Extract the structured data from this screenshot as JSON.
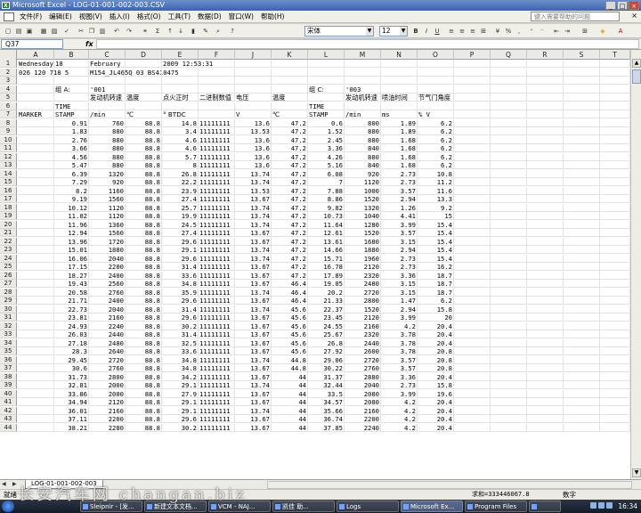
{
  "window": {
    "title": "Microsoft Excel - LOG-01-001-002-003.CSV",
    "controls": [
      "_",
      "□",
      "×"
    ]
  },
  "menu": {
    "items": [
      "文件(F)",
      "编辑(E)",
      "视图(V)",
      "插入(I)",
      "格式(O)",
      "工具(T)",
      "数据(D)",
      "窗口(W)",
      "帮助(H)"
    ],
    "help_placeholder": "键入需要帮助的问题"
  },
  "toolbar": {
    "font": "宋体",
    "font_size": "12",
    "bold": "B",
    "italic": "I",
    "underline": "U",
    "sum": "Σ"
  },
  "formula_bar": {
    "name_box": "Q37",
    "fx": "fx",
    "content": ""
  },
  "columns": [
    "A",
    "B",
    "C",
    "D",
    "E",
    "F",
    "J",
    "K",
    "L",
    "M",
    "N",
    "O",
    "P",
    "Q",
    "R",
    "S",
    "T"
  ],
  "rows": [
    {
      "n": "1",
      "cells": [
        "Wednesday",
        "18",
        "February",
        "",
        "2009 12:53:31",
        "",
        "",
        "",
        "",
        "",
        "",
        "",
        "",
        "",
        "",
        "",
        ""
      ]
    },
    {
      "n": "2",
      "cells": [
        "026 120 718 5",
        "",
        "M154_JL465Q 03_BS410475",
        "",
        "",
        "",
        "",
        "",
        "",
        "",
        "",
        "",
        "",
        "",
        "",
        "",
        ""
      ]
    },
    {
      "n": "3",
      "cells": [
        "",
        "",
        "",
        "",
        "",
        "",
        "",
        "",
        "",
        "",
        "",
        "",
        "",
        "",
        "",
        "",
        ""
      ]
    },
    {
      "n": "4",
      "cells": [
        "",
        "组 A:",
        "'001",
        "",
        "",
        "",
        "",
        "",
        "组 C:",
        "'003",
        "",
        "",
        "",
        "",
        "",
        "",
        ""
      ]
    },
    {
      "n": "5",
      "cells": [
        "",
        "",
        "发动机转速",
        "温度",
        "点火正时",
        "二进制数值",
        "电压",
        "温度",
        "",
        "发动机转速",
        "喷油时间",
        "节气门角度",
        "",
        "",
        "",
        "",
        ""
      ]
    },
    {
      "n": "6",
      "cells": [
        "",
        "TIME",
        "",
        "",
        "",
        "",
        "",
        "",
        "TIME",
        "",
        "",
        "",
        "",
        "",
        "",
        "",
        ""
      ]
    },
    {
      "n": "7",
      "cells": [
        "MARKER",
        "STAMP",
        "/min",
        "℃",
        "° BTDC",
        "",
        "V",
        "℃",
        "STAMP",
        "/min",
        "ms",
        "% V",
        "",
        "",
        "",
        "",
        ""
      ]
    },
    {
      "n": "8",
      "cells": [
        "",
        "0.91",
        "760",
        "88.8",
        "14.8",
        "11111111",
        "13.6",
        "47.2",
        "0.6",
        "800",
        "1.89",
        "6.2",
        "",
        "",
        "",
        "",
        ""
      ]
    },
    {
      "n": "9",
      "cells": [
        "",
        "1.83",
        "880",
        "88.8",
        "3.4",
        "11111111",
        "13.53",
        "47.2",
        "1.52",
        "880",
        "1.89",
        "6.2",
        "",
        "",
        "",
        "",
        ""
      ]
    },
    {
      "n": "10",
      "cells": [
        "",
        "2.76",
        "880",
        "88.8",
        "4.6",
        "11111111",
        "13.6",
        "47.2",
        "2.45",
        "880",
        "1.68",
        "6.2",
        "",
        "",
        "",
        "",
        ""
      ]
    },
    {
      "n": "11",
      "cells": [
        "",
        "3.66",
        "880",
        "88.8",
        "4.6",
        "11111111",
        "13.6",
        "47.2",
        "3.36",
        "840",
        "1.68",
        "6.2",
        "",
        "",
        "",
        "",
        ""
      ]
    },
    {
      "n": "12",
      "cells": [
        "",
        "4.56",
        "880",
        "88.8",
        "5.7",
        "11111111",
        "13.6",
        "47.2",
        "4.26",
        "880",
        "1.68",
        "6.2",
        "",
        "",
        "",
        "",
        ""
      ]
    },
    {
      "n": "13",
      "cells": [
        "",
        "5.47",
        "880",
        "88.8",
        "8",
        "11111111",
        "13.6",
        "47.2",
        "5.16",
        "840",
        "1.68",
        "6.2",
        "",
        "",
        "",
        "",
        ""
      ]
    },
    {
      "n": "14",
      "cells": [
        "",
        "6.39",
        "1320",
        "88.8",
        "26.8",
        "11111111",
        "13.74",
        "47.2",
        "6.08",
        "920",
        "2.73",
        "10.8",
        "",
        "",
        "",
        "",
        ""
      ]
    },
    {
      "n": "15",
      "cells": [
        "",
        "7.29",
        "920",
        "88.8",
        "22.2",
        "11111111",
        "13.74",
        "47.2",
        "7",
        "1120",
        "2.73",
        "11.2",
        "",
        "",
        "",
        "",
        ""
      ]
    },
    {
      "n": "16",
      "cells": [
        "",
        "8.2",
        "1160",
        "88.8",
        "23.9",
        "11111111",
        "13.53",
        "47.2",
        "7.88",
        "1000",
        "3.57",
        "11.6",
        "",
        "",
        "",
        "",
        ""
      ]
    },
    {
      "n": "17",
      "cells": [
        "",
        "9.19",
        "1560",
        "88.8",
        "27.4",
        "11111111",
        "13.67",
        "47.2",
        "8.86",
        "1520",
        "2.94",
        "13.3",
        "",
        "",
        "",
        "",
        ""
      ]
    },
    {
      "n": "18",
      "cells": [
        "",
        "10.12",
        "1120",
        "88.8",
        "25.7",
        "11111111",
        "13.74",
        "47.2",
        "9.82",
        "1320",
        "1.26",
        "9.2",
        "",
        "",
        "",
        "",
        ""
      ]
    },
    {
      "n": "19",
      "cells": [
        "",
        "11.02",
        "1120",
        "88.8",
        "19.9",
        "11111111",
        "13.74",
        "47.2",
        "10.73",
        "1040",
        "4.41",
        "15",
        "",
        "",
        "",
        "",
        ""
      ]
    },
    {
      "n": "20",
      "cells": [
        "",
        "11.96",
        "1360",
        "88.8",
        "24.5",
        "11111111",
        "13.74",
        "47.2",
        "11.64",
        "1280",
        "3.99",
        "15.4",
        "",
        "",
        "",
        "",
        ""
      ]
    },
    {
      "n": "21",
      "cells": [
        "",
        "12.94",
        "1560",
        "88.8",
        "27.4",
        "11111111",
        "13.67",
        "47.2",
        "12.61",
        "1520",
        "3.57",
        "15.4",
        "",
        "",
        "",
        "",
        ""
      ]
    },
    {
      "n": "22",
      "cells": [
        "",
        "13.96",
        "1720",
        "88.8",
        "29.6",
        "11111111",
        "13.67",
        "47.2",
        "13.61",
        "1680",
        "3.15",
        "15.4",
        "",
        "",
        "",
        "",
        ""
      ]
    },
    {
      "n": "23",
      "cells": [
        "",
        "15.01",
        "1880",
        "88.8",
        "29.1",
        "11111111",
        "13.74",
        "47.2",
        "14.66",
        "1880",
        "2.94",
        "15.4",
        "",
        "",
        "",
        "",
        ""
      ]
    },
    {
      "n": "24",
      "cells": [
        "",
        "16.06",
        "2040",
        "88.8",
        "29.6",
        "11111111",
        "13.74",
        "47.2",
        "15.71",
        "1960",
        "2.73",
        "15.4",
        "",
        "",
        "",
        "",
        ""
      ]
    },
    {
      "n": "25",
      "cells": [
        "",
        "17.15",
        "2200",
        "88.8",
        "31.4",
        "11111111",
        "13.67",
        "47.2",
        "16.78",
        "2120",
        "2.73",
        "16.2",
        "",
        "",
        "",
        "",
        ""
      ]
    },
    {
      "n": "26",
      "cells": [
        "",
        "18.27",
        "2400",
        "88.8",
        "33.6",
        "11111111",
        "13.67",
        "47.2",
        "17.89",
        "2320",
        "3.36",
        "18.7",
        "",
        "",
        "",
        "",
        ""
      ]
    },
    {
      "n": "27",
      "cells": [
        "",
        "19.43",
        "2560",
        "88.8",
        "34.8",
        "11111111",
        "13.67",
        "46.4",
        "19.05",
        "2480",
        "3.15",
        "18.7",
        "",
        "",
        "",
        "",
        ""
      ]
    },
    {
      "n": "28",
      "cells": [
        "",
        "20.58",
        "2760",
        "88.8",
        "35.9",
        "11111111",
        "13.74",
        "46.4",
        "20.2",
        "2720",
        "3.15",
        "18.7",
        "",
        "",
        "",
        "",
        ""
      ]
    },
    {
      "n": "29",
      "cells": [
        "",
        "21.71",
        "2400",
        "88.8",
        "29.6",
        "11111111",
        "13.67",
        "46.4",
        "21.33",
        "2800",
        "1.47",
        "6.2",
        "",
        "",
        "",
        "",
        ""
      ]
    },
    {
      "n": "30",
      "cells": [
        "",
        "22.73",
        "2040",
        "88.8",
        "31.4",
        "11111111",
        "13.74",
        "45.6",
        "22.37",
        "1520",
        "2.94",
        "15.8",
        "",
        "",
        "",
        "",
        ""
      ]
    },
    {
      "n": "31",
      "cells": [
        "",
        "23.81",
        "2160",
        "88.8",
        "29.6",
        "11111111",
        "13.67",
        "45.6",
        "23.45",
        "2120",
        "3.99",
        "20",
        "",
        "",
        "",
        "",
        ""
      ]
    },
    {
      "n": "32",
      "cells": [
        "",
        "24.93",
        "2240",
        "88.8",
        "30.2",
        "11111111",
        "13.67",
        "45.6",
        "24.55",
        "2160",
        "4.2",
        "20.4",
        "",
        "",
        "",
        "",
        ""
      ]
    },
    {
      "n": "33",
      "cells": [
        "",
        "26.03",
        "2440",
        "88.8",
        "31.4",
        "11111111",
        "13.67",
        "45.6",
        "25.67",
        "2320",
        "3.78",
        "20.4",
        "",
        "",
        "",
        "",
        ""
      ]
    },
    {
      "n": "34",
      "cells": [
        "",
        "27.18",
        "2480",
        "88.8",
        "32.5",
        "11111111",
        "13.67",
        "45.6",
        "26.8",
        "2440",
        "3.78",
        "20.4",
        "",
        "",
        "",
        "",
        ""
      ]
    },
    {
      "n": "35",
      "cells": [
        "",
        "28.3",
        "2640",
        "88.8",
        "33.6",
        "11111111",
        "13.67",
        "45.6",
        "27.92",
        "2600",
        "3.78",
        "20.8",
        "",
        "",
        "",
        "",
        ""
      ]
    },
    {
      "n": "36",
      "cells": [
        "",
        "29.45",
        "2720",
        "88.8",
        "34.8",
        "11111111",
        "13.74",
        "44.8",
        "29.06",
        "2720",
        "3.57",
        "20.8",
        "",
        "",
        "",
        "",
        ""
      ]
    },
    {
      "n": "37",
      "cells": [
        "",
        "30.6",
        "2760",
        "88.8",
        "34.8",
        "11111111",
        "13.67",
        "44.8",
        "30.22",
        "2760",
        "3.57",
        "20.8",
        "",
        "",
        "",
        "",
        ""
      ]
    },
    {
      "n": "38",
      "cells": [
        "",
        "31.73",
        "2800",
        "88.8",
        "34.2",
        "11111111",
        "13.67",
        "44",
        "31.37",
        "2880",
        "3.36",
        "20.4",
        "",
        "",
        "",
        "",
        ""
      ]
    },
    {
      "n": "39",
      "cells": [
        "",
        "32.81",
        "2000",
        "88.8",
        "29.1",
        "11111111",
        "13.74",
        "44",
        "32.44",
        "2040",
        "2.73",
        "15.8",
        "",
        "",
        "",
        "",
        ""
      ]
    },
    {
      "n": "40",
      "cells": [
        "",
        "33.86",
        "2000",
        "88.8",
        "27.9",
        "11111111",
        "13.67",
        "44",
        "33.5",
        "2080",
        "3.99",
        "19.6",
        "",
        "",
        "",
        "",
        ""
      ]
    },
    {
      "n": "41",
      "cells": [
        "",
        "34.94",
        "2120",
        "88.8",
        "29.1",
        "11111111",
        "13.67",
        "44",
        "34.57",
        "2080",
        "4.2",
        "20.4",
        "",
        "",
        "",
        "",
        ""
      ]
    },
    {
      "n": "42",
      "cells": [
        "",
        "36.01",
        "2160",
        "88.8",
        "29.1",
        "11111111",
        "13.74",
        "44",
        "35.66",
        "2160",
        "4.2",
        "20.4",
        "",
        "",
        "",
        "",
        ""
      ]
    },
    {
      "n": "43",
      "cells": [
        "",
        "37.11",
        "2200",
        "88.8",
        "29.6",
        "11111111",
        "13.67",
        "44",
        "36.74",
        "2200",
        "4.2",
        "20.4",
        "",
        "",
        "",
        "",
        ""
      ]
    },
    {
      "n": "44",
      "cells": [
        "",
        "38.21",
        "2280",
        "88.8",
        "30.2",
        "11111111",
        "13.67",
        "44",
        "37.85",
        "2240",
        "4.2",
        "20.4",
        "",
        "",
        "",
        "",
        ""
      ]
    }
  ],
  "sheet_tab": "LOG-01-001-002-003",
  "status": {
    "ready": "就绪",
    "sum": "求和=333446067.8",
    "mode": "数字"
  },
  "taskbar": {
    "tasks": [
      "Sleipnir - [发...",
      "新建文本文档...",
      "VCM - NAJ...",
      "凯佳 助...",
      "Logs",
      "Microsoft Ex...",
      "Program Files",
      ""
    ],
    "clock": "16:34"
  },
  "watermark": "长安汽车网 changan.biz",
  "colors": {
    "titlebar": "#3b63b0",
    "taskbar": "#141a26",
    "grid": "#e2e2e2"
  }
}
